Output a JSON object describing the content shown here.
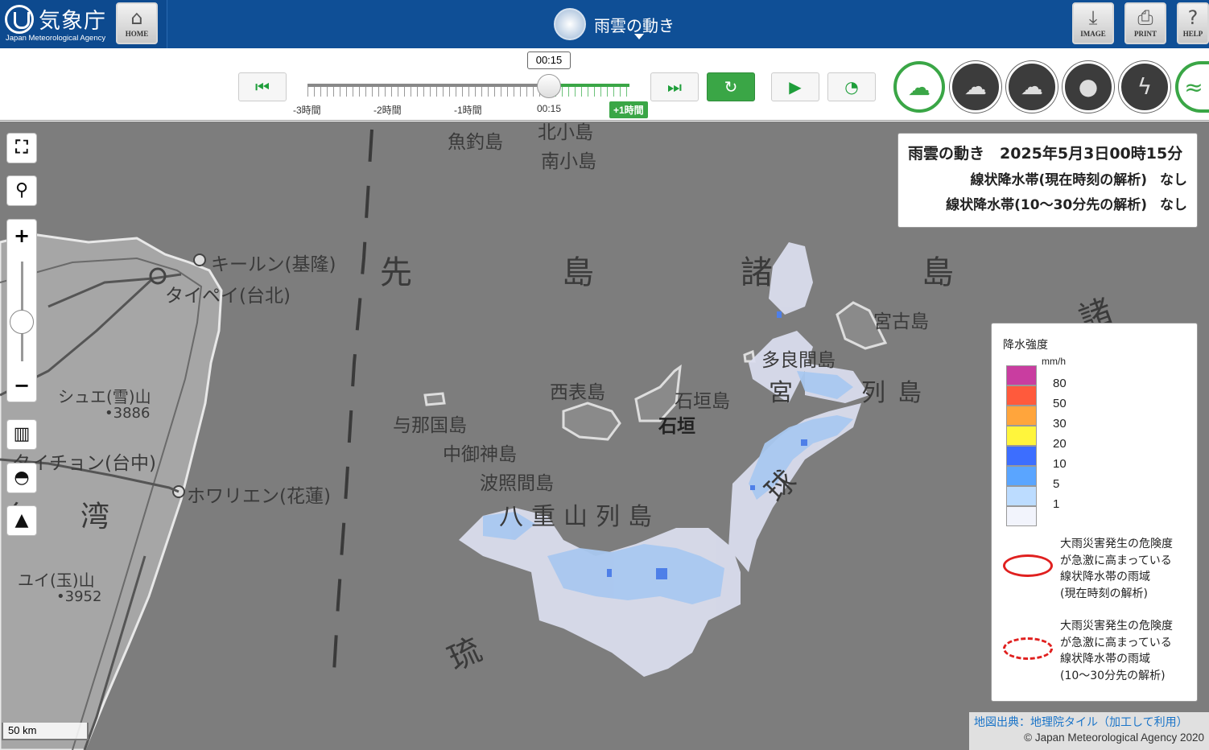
{
  "header": {
    "logo_ja": "気象庁",
    "logo_en": "Japan Meteorological Agency",
    "home_label": "HOME",
    "title": "雨雲の動き",
    "image_label": "IMAGE",
    "print_label": "PRINT",
    "help_label": "HELP"
  },
  "timeline": {
    "current_time": "00:15",
    "labels": [
      "-3時間",
      "-2時間",
      "-1時間",
      "00:15",
      "+1時間"
    ],
    "position_fraction": 0.75
  },
  "cloud_types": [
    {
      "name": "rain-cloud-icon",
      "active": true
    },
    {
      "name": "thunder-cloud-icon",
      "active": false
    },
    {
      "name": "tornado-cloud-icon",
      "active": false
    },
    {
      "name": "drop-icon",
      "active": false
    },
    {
      "name": "lightning-icon",
      "active": false
    },
    {
      "name": "wave-icon",
      "active": false
    }
  ],
  "info": {
    "title": "雨雲の動き　2025年5月3日00時15分",
    "row1_label": "線状降水帯(現在時刻の解析)",
    "row1_value": "なし",
    "row2_label": "線状降水帯(10〜30分先の解析)",
    "row2_value": "なし"
  },
  "legend": {
    "title": "降水強度",
    "unit": "mm/h",
    "levels": [
      {
        "label": "80",
        "color": "#c93da0"
      },
      {
        "label": "50",
        "color": "#ff5a3c"
      },
      {
        "label": "30",
        "color": "#ffa53c"
      },
      {
        "label": "20",
        "color": "#fff53c"
      },
      {
        "label": "10",
        "color": "#3c6eff"
      },
      {
        "label": "5",
        "color": "#5aa5ff"
      },
      {
        "label": "1",
        "color": "#bcdcff"
      },
      {
        "label": "",
        "color": "#f2f4fc"
      }
    ],
    "solid_desc": [
      "大雨災害発生の危険度",
      "が急激に高まっている",
      "線状降水帯の雨域",
      "(現在時刻の解析)"
    ],
    "dash_desc": [
      "大雨災害発生の危険度",
      "が急激に高まっている",
      "線状降水帯の雨域",
      "(10〜30分先の解析)"
    ]
  },
  "map_labels": {
    "uotsurijima": "魚釣島",
    "kitakojima": "北小島",
    "minamikojima": "南小島",
    "saki": "先",
    "shima1": "島",
    "sho": "諸",
    "shima2": "島",
    "sho2": "諸",
    "keelung": "キールン(基隆)",
    "taipei": "タイペイ(台北)",
    "miyakojima": "宮古島",
    "tarama": "多良間島",
    "miyako": "宮",
    "retto": "列",
    "shima3": "島",
    "iriomote": "西表島",
    "ishigakijima": "石垣島",
    "ishigaki": "石垣",
    "yonaguni": "与那国島",
    "nakanokami": "中御神島",
    "hateruma": "波照間島",
    "yaeyama": "八重山列島",
    "shue": "シュエ(雪)山",
    "shue_h": "•3886",
    "taichung": "タイチョン(台中)",
    "hualien": "ホワリエン(花蓮)",
    "wan": "湾",
    "wan2": "台",
    "yushan": "ユイ(玉)山",
    "yushan_h": "•3952",
    "ryu": "琉",
    "kyu": "球"
  },
  "scale": "50 km",
  "attribution": {
    "source": "地図出典：地理院タイル（加工して利用）",
    "copyright": "© Japan Meteorological Agency 2020"
  }
}
